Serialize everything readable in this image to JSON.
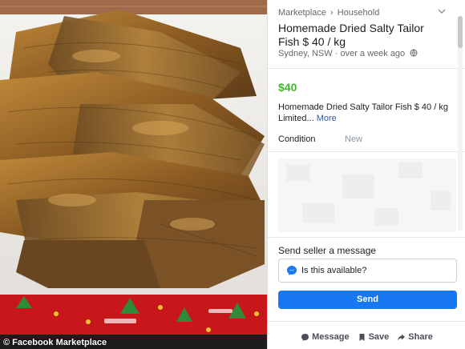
{
  "photo": {
    "watermark": "© Facebook Marketplace"
  },
  "breadcrumb": {
    "root": "Marketplace",
    "separator": "›",
    "category": "Household"
  },
  "listing": {
    "title": "Homemade Dried Salty Tailor Fish $ 40 / kg",
    "location": "Sydney, NSW",
    "posted": "over a week ago",
    "location_separator": "·",
    "price": "$40",
    "description": "Homemade Dried Salty Tailor Fish $ 40 / kg Limited...",
    "more_label": "More",
    "condition_label": "Condition",
    "condition_value": "New"
  },
  "message": {
    "heading": "Send seller a message",
    "input_value": "Is this available?",
    "send_label": "Send"
  },
  "actions": {
    "message": "Message",
    "save": "Save",
    "share": "Share"
  },
  "colors": {
    "price": "#42b72a",
    "send_button": "#1877f2",
    "link": "#385898"
  },
  "icons": [
    "chevron-down-icon",
    "globe-icon",
    "messenger-icon",
    "message-icon",
    "bookmark-icon",
    "share-arrow-icon"
  ]
}
